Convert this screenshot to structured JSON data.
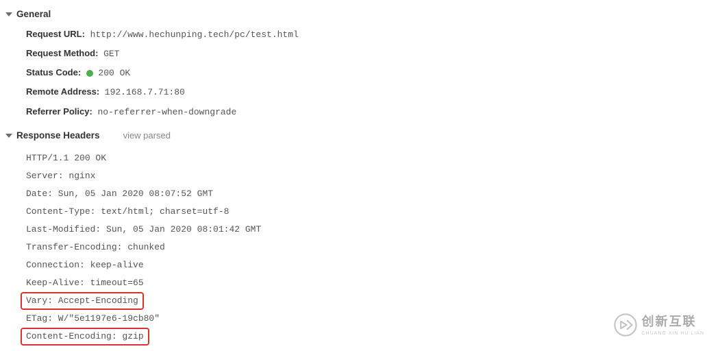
{
  "sections": {
    "general": {
      "title": "General",
      "items": {
        "request_url": {
          "label": "Request URL:",
          "value": "http://www.hechunping.tech/pc/test.html"
        },
        "request_method": {
          "label": "Request Method:",
          "value": "GET"
        },
        "status_code": {
          "label": "Status Code:",
          "value": "200 OK",
          "status_color": "#4caf50"
        },
        "remote_address": {
          "label": "Remote Address:",
          "value": "192.168.7.71:80"
        },
        "referrer_policy": {
          "label": "Referrer Policy:",
          "value": "no-referrer-when-downgrade"
        }
      }
    },
    "response_headers": {
      "title": "Response Headers",
      "view_parsed_label": "view parsed",
      "lines": [
        "HTTP/1.1 200 OK",
        "Server: nginx",
        "Date: Sun, 05 Jan 2020 08:07:52 GMT",
        "Content-Type: text/html; charset=utf-8",
        "Last-Modified: Sun, 05 Jan 2020 08:01:42 GMT",
        "Transfer-Encoding: chunked",
        "Connection: keep-alive",
        "Keep-Alive: timeout=65",
        "Vary: Accept-Encoding",
        "ETag: W/\"5e1197e6-19cb80\"",
        "Content-Encoding: gzip"
      ],
      "highlighted_line_indices": [
        8,
        10
      ]
    }
  },
  "watermark": {
    "cn_text": "创新互联",
    "en_text": "CHUANG XIN HU LIAN"
  }
}
